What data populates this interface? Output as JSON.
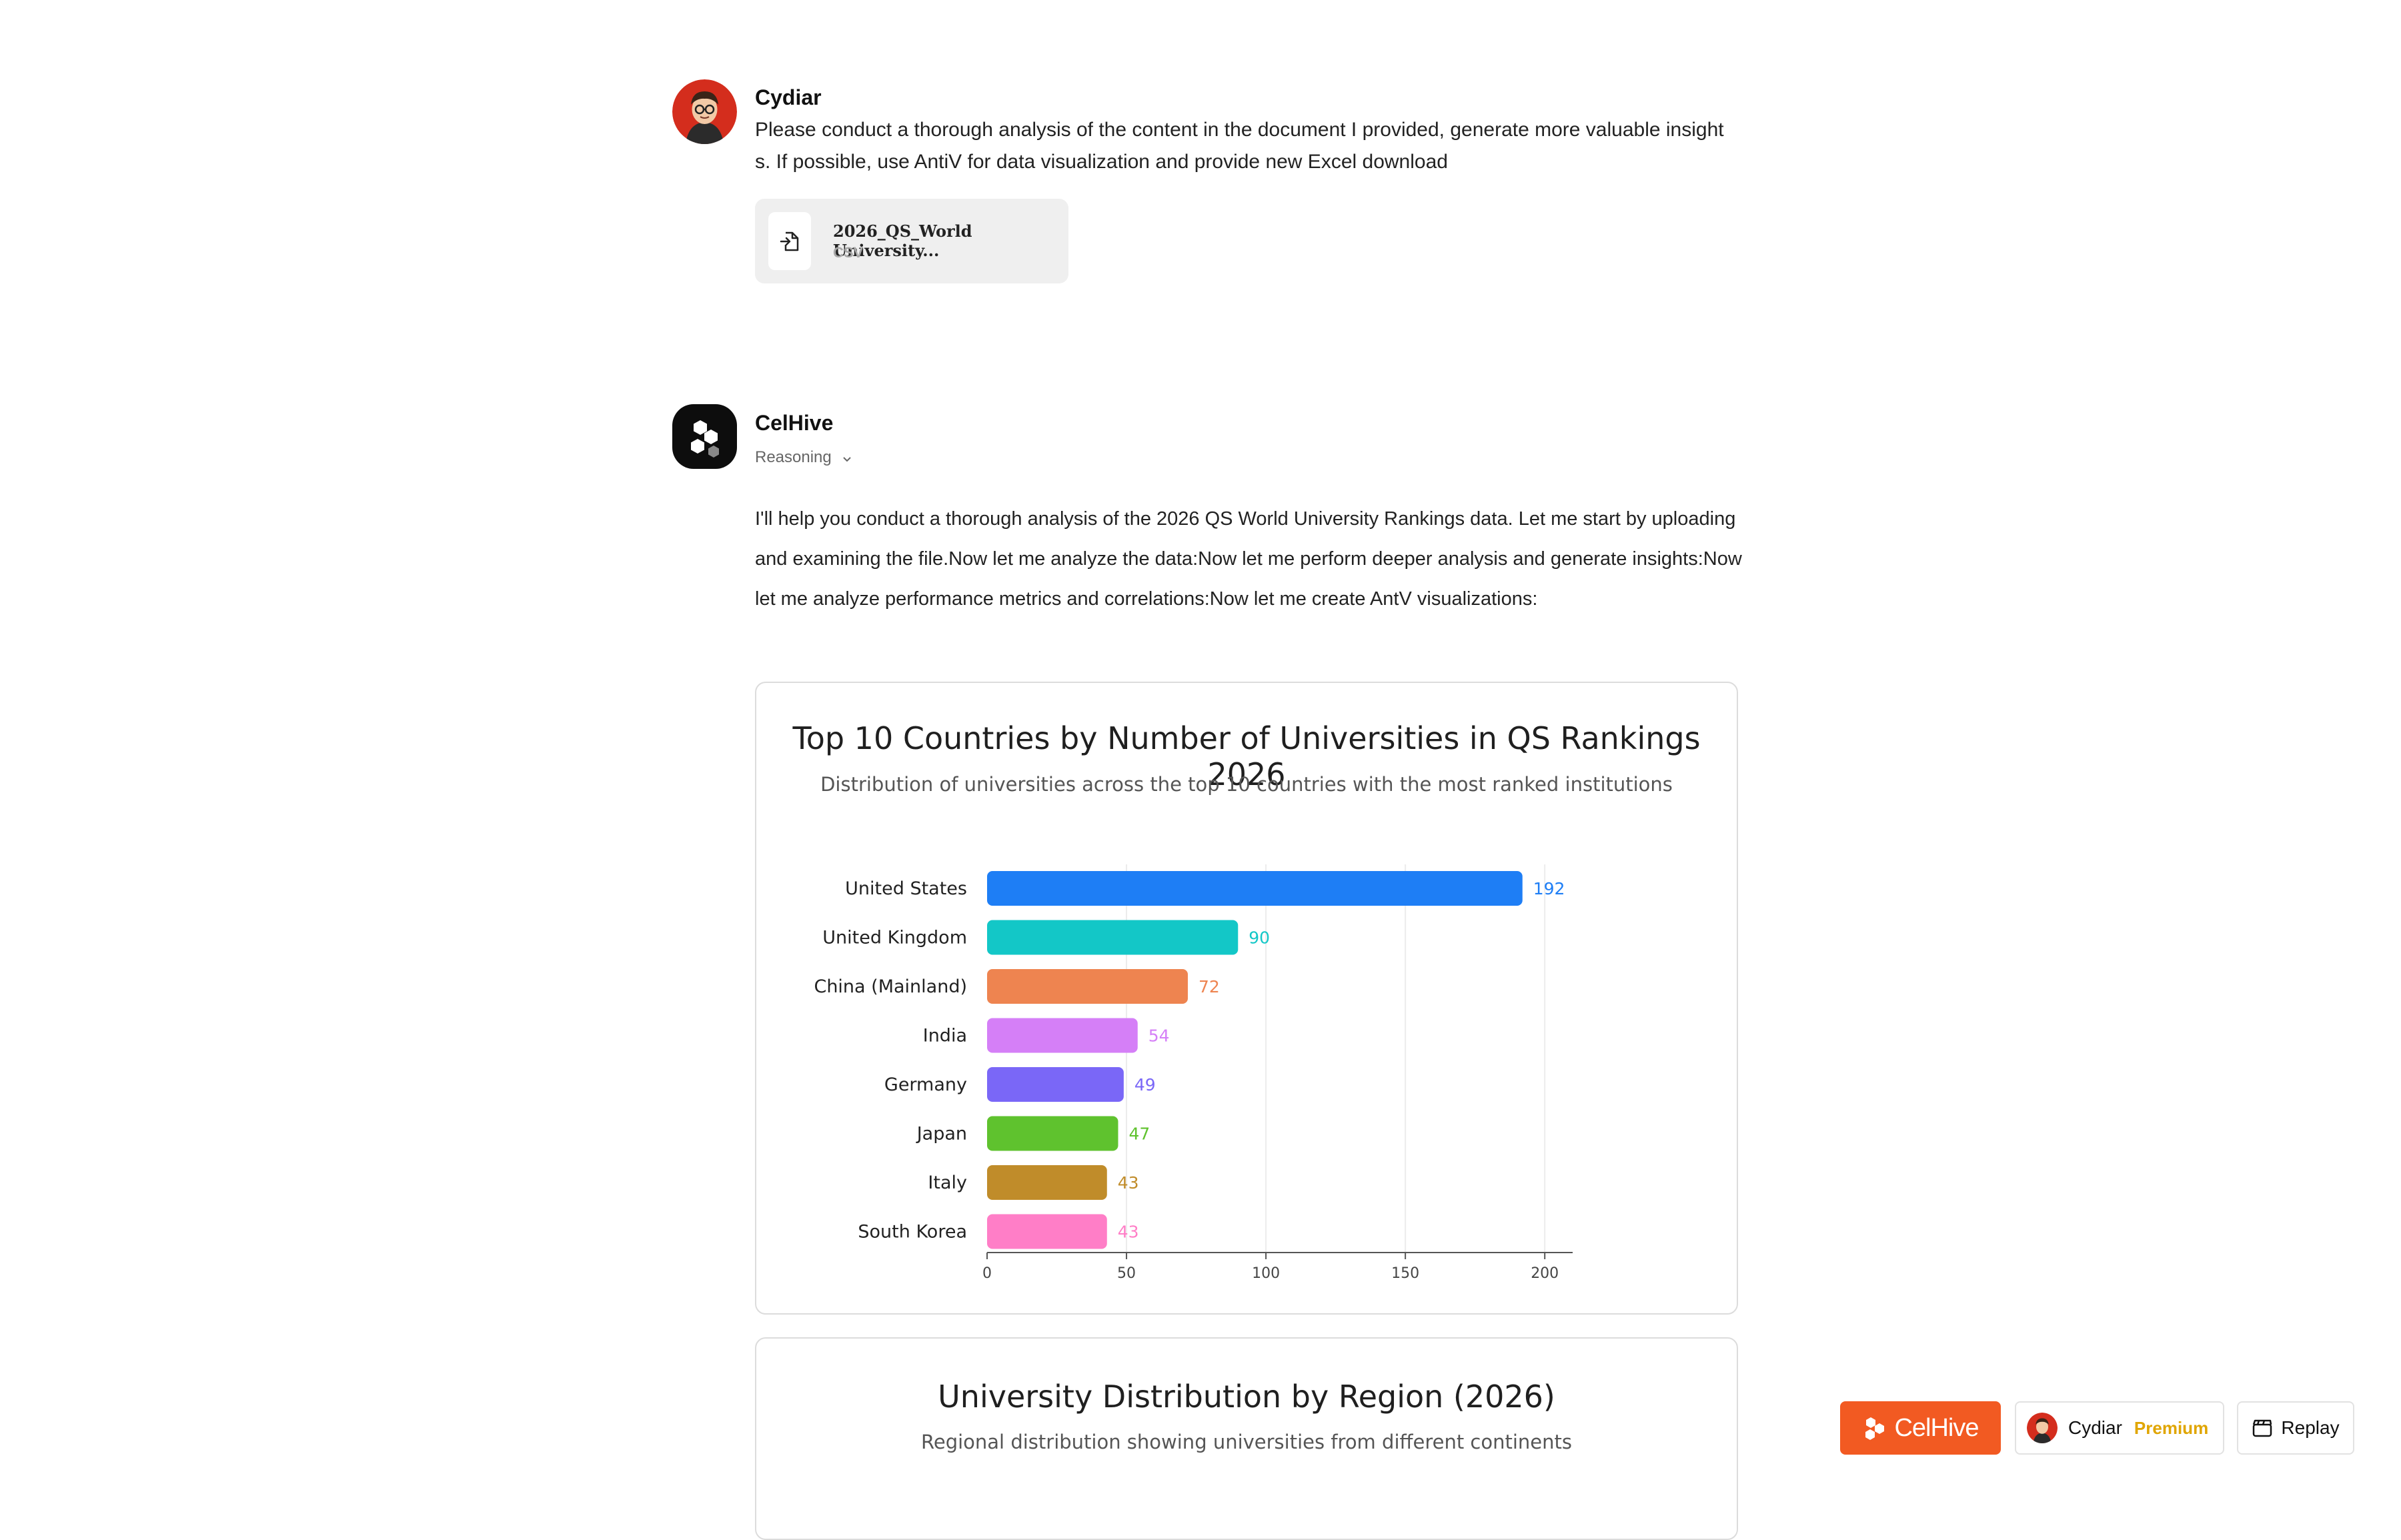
{
  "user_message": {
    "name": "Cydiar",
    "text": "Please conduct a thorough analysis of the content in the document I provided, generate more valuable insights. If possible, use AntiV for data visualization and provide new Excel download",
    "attachment": {
      "name": "2026_QS_World University...",
      "type": "CSV",
      "icon": "file-import-icon"
    }
  },
  "assistant_message": {
    "name": "CelHive",
    "reasoning_label": "Reasoning",
    "text": "I'll help you conduct a thorough analysis of the 2026 QS World University Rankings data. Let me start by uploading and examining the file.Now let me analyze the data:Now let me perform deeper analysis and generate insights:Now let me analyze performance metrics and correlations:Now let me create AntV visualizations:"
  },
  "chart_data": [
    {
      "type": "bar",
      "orientation": "horizontal",
      "title": "Top 10 Countries by Number of Universities in QS Rankings 2026",
      "subtitle": "Distribution of universities across the top 10 countries with the most ranked institutions",
      "categories": [
        "United States",
        "United Kingdom",
        "China (Mainland)",
        "India",
        "Germany",
        "Japan",
        "Italy",
        "South Korea"
      ],
      "values": [
        192,
        90,
        72,
        54,
        49,
        47,
        43,
        43
      ],
      "colors": [
        "#1e7ef5",
        "#13c7c7",
        "#ee8450",
        "#d57ff7",
        "#7a67f7",
        "#5fc22e",
        "#c08c2a",
        "#ff7ec7"
      ],
      "xticks": [
        0,
        50,
        100,
        150,
        200
      ],
      "xlim": [
        0,
        210
      ],
      "grid": true
    },
    {
      "type": "pie",
      "title": "University Distribution by Region (2026)",
      "subtitle": "Regional distribution showing universities from different continents"
    }
  ],
  "bottom_bar": {
    "brand": "CelHive",
    "user_name": "Cydiar",
    "plan": "Premium",
    "replay": "Replay"
  }
}
